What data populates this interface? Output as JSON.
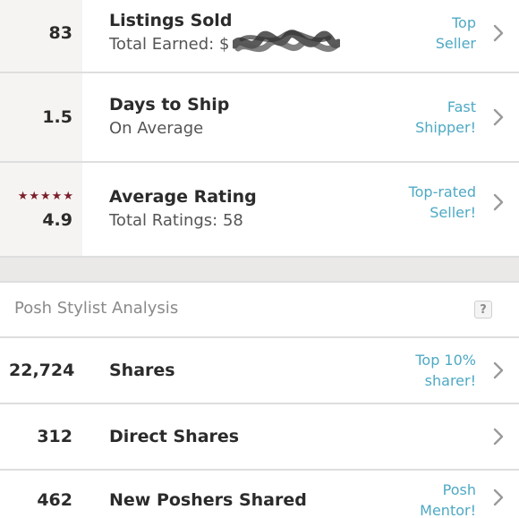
{
  "seller_stats": [
    {
      "value": "83",
      "title": "Listings Sold",
      "subtitle": "Total Earned: $",
      "badge_line1": "Top",
      "badge_line2": "Seller"
    },
    {
      "value": "1.5",
      "title": "Days to Ship",
      "subtitle": "On Average",
      "badge_line1": "Fast",
      "badge_line2": "Shipper!"
    },
    {
      "value": "4.9",
      "stars": "★★★★★",
      "title": "Average Rating",
      "subtitle": "Total Ratings: 58",
      "badge_line1": "Top-rated",
      "badge_line2": "Seller!"
    }
  ],
  "stylist_section": {
    "title": "Posh Stylist Analysis",
    "help_label": "?"
  },
  "stylist_stats": [
    {
      "value": "22,724",
      "title": "Shares",
      "badge_line1": "Top 10%",
      "badge_line2": "sharer!"
    },
    {
      "value": "312",
      "title": "Direct Shares",
      "badge_line1": "",
      "badge_line2": ""
    },
    {
      "value": "462",
      "title": "New Poshers Shared",
      "badge_line1": "Posh",
      "badge_line2": "Mentor!"
    }
  ],
  "colors": {
    "badge_text": "#4ea9c4",
    "stars": "#7a1f2b",
    "stat_column_bg": "#f6f4f2",
    "divider": "#dedede"
  },
  "icons": {
    "row_chevron": "chevron-right-icon",
    "rating_stars": "star-icon",
    "help": "question-icon"
  }
}
